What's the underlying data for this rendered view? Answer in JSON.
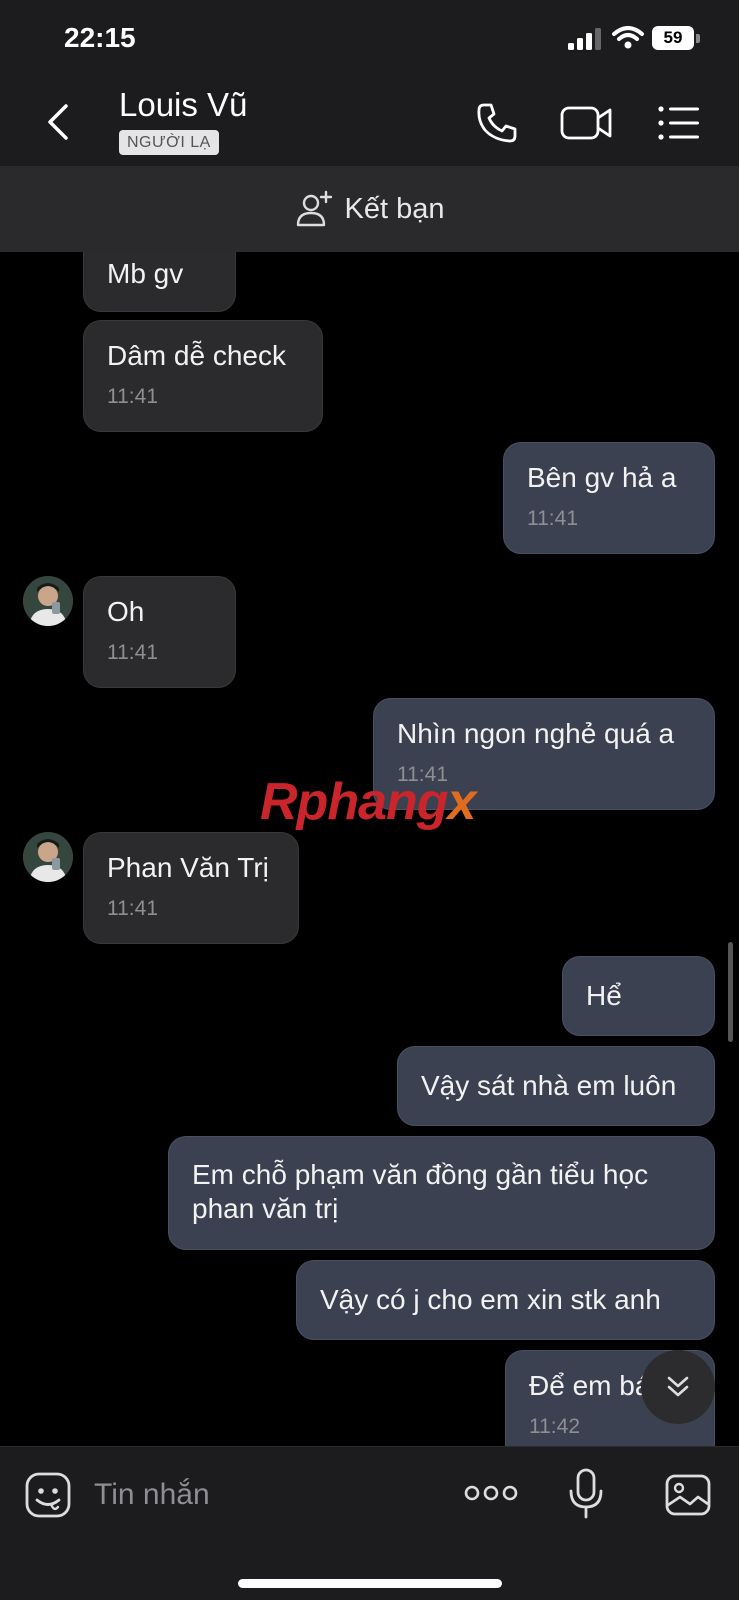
{
  "status_bar": {
    "time": "22:15",
    "battery": "59"
  },
  "header": {
    "contact_name": "Louis Vũ",
    "badge": "NGƯỜI LẠ"
  },
  "friend_bar": {
    "label": "Kết bạn"
  },
  "messages": [
    {
      "side": "in",
      "text": "Mb gv",
      "time": ""
    },
    {
      "side": "in",
      "text": "Dâm dễ check",
      "time": "11:41"
    },
    {
      "side": "out",
      "text": "Bên gv hả a",
      "time": "11:41"
    },
    {
      "side": "in",
      "text": "Oh",
      "time": "11:41"
    },
    {
      "side": "out",
      "text": "Nhìn ngon nghẻ quá a",
      "time": "11:41"
    },
    {
      "side": "in",
      "text": "Phan Văn Trị",
      "time": "11:41"
    },
    {
      "side": "out",
      "text": "Hể",
      "time": ""
    },
    {
      "side": "out",
      "text": "Vậy sát nhà em luôn",
      "time": ""
    },
    {
      "side": "out",
      "text": "Em chỗ phạm văn đồng gần tiểu học phan văn trị",
      "time": ""
    },
    {
      "side": "out",
      "text": "Vậy có j cho em xin stk anh",
      "time": ""
    },
    {
      "side": "out",
      "text": "Để em bá",
      "time": "11:42"
    }
  ],
  "watermark": {
    "part1": "Rphang",
    "part2": "x"
  },
  "input": {
    "placeholder": "Tin nhắn"
  },
  "colors": {
    "incoming": "#2b2b2d",
    "outgoing": "#3b4150",
    "background": "#000000",
    "bar": "#1c1c1e"
  }
}
